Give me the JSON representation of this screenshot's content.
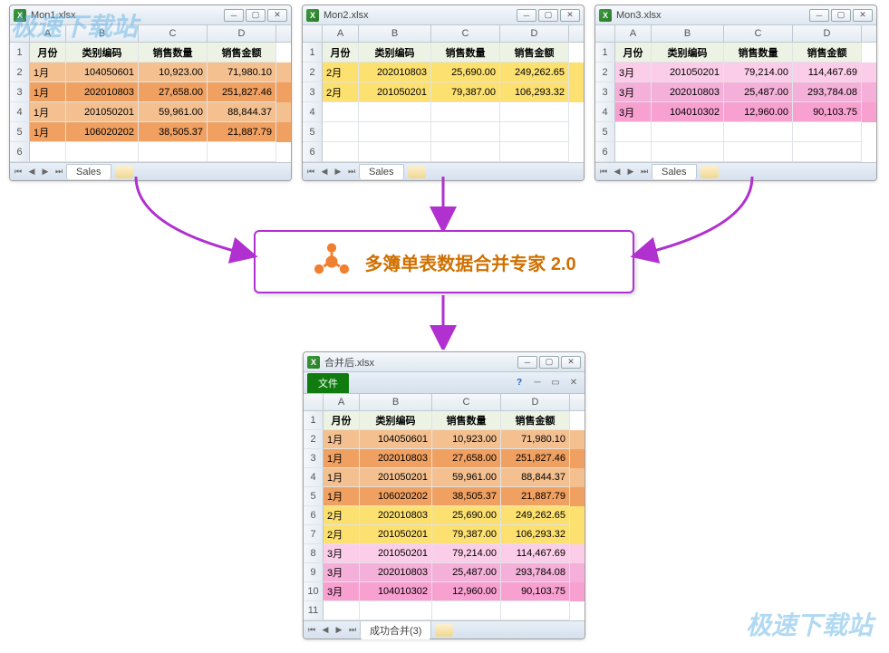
{
  "watermark": "极速下载站",
  "tool": {
    "title": "多簿单表数据合并专家 2.0"
  },
  "columns": [
    "A",
    "B",
    "C",
    "D"
  ],
  "headers": [
    "月份",
    "类别编码",
    "销售数量",
    "销售金额"
  ],
  "windows": {
    "w1": {
      "title": "Mon1.xlsx",
      "sheet": "Sales",
      "rows": [
        {
          "m": "1月",
          "code": "104050601",
          "qty": "10,923.00",
          "amt": "71,980.10",
          "cls": "row-orange"
        },
        {
          "m": "1月",
          "code": "202010803",
          "qty": "27,658.00",
          "amt": "251,827.46",
          "cls": "row-dark-orange"
        },
        {
          "m": "1月",
          "code": "201050201",
          "qty": "59,961.00",
          "amt": "88,844.37",
          "cls": "row-orange"
        },
        {
          "m": "1月",
          "code": "106020202",
          "qty": "38,505.37",
          "amt": "21,887.79",
          "cls": "row-dark-orange"
        }
      ]
    },
    "w2": {
      "title": "Mon2.xlsx",
      "sheet": "Sales",
      "rows": [
        {
          "m": "2月",
          "code": "202010803",
          "qty": "25,690.00",
          "amt": "249,262.65",
          "cls": "row-yellow"
        },
        {
          "m": "2月",
          "code": "201050201",
          "qty": "79,387.00",
          "amt": "106,293.32",
          "cls": "row-yellow"
        }
      ]
    },
    "w3": {
      "title": "Mon3.xlsx",
      "sheet": "Sales",
      "rows": [
        {
          "m": "3月",
          "code": "201050201",
          "qty": "79,214.00",
          "amt": "114,467.69",
          "cls": "row-light-pink"
        },
        {
          "m": "3月",
          "code": "202010803",
          "qty": "25,487.00",
          "amt": "293,784.08",
          "cls": "row-pink"
        },
        {
          "m": "3月",
          "code": "104010302",
          "qty": "12,960.00",
          "amt": "90,103.75",
          "cls": "row-pink2"
        }
      ]
    },
    "result": {
      "title": "合并后.xlsx",
      "file_label": "文件",
      "sheet": "成功合并(3)",
      "rows": [
        {
          "m": "1月",
          "code": "104050601",
          "qty": "10,923.00",
          "amt": "71,980.10",
          "cls": "row-orange"
        },
        {
          "m": "1月",
          "code": "202010803",
          "qty": "27,658.00",
          "amt": "251,827.46",
          "cls": "row-dark-orange"
        },
        {
          "m": "1月",
          "code": "201050201",
          "qty": "59,961.00",
          "amt": "88,844.37",
          "cls": "row-orange"
        },
        {
          "m": "1月",
          "code": "106020202",
          "qty": "38,505.37",
          "amt": "21,887.79",
          "cls": "row-dark-orange"
        },
        {
          "m": "2月",
          "code": "202010803",
          "qty": "25,690.00",
          "amt": "249,262.65",
          "cls": "row-yellow"
        },
        {
          "m": "2月",
          "code": "201050201",
          "qty": "79,387.00",
          "amt": "106,293.32",
          "cls": "row-yellow"
        },
        {
          "m": "3月",
          "code": "201050201",
          "qty": "79,214.00",
          "amt": "114,467.69",
          "cls": "row-light-pink"
        },
        {
          "m": "3月",
          "code": "202010803",
          "qty": "25,487.00",
          "amt": "293,784.08",
          "cls": "row-pink"
        },
        {
          "m": "3月",
          "code": "104010302",
          "qty": "12,960.00",
          "amt": "90,103.75",
          "cls": "row-pink2"
        }
      ]
    }
  },
  "col_widths": {
    "a": 40,
    "b": 80,
    "c": 76,
    "d": 76
  }
}
